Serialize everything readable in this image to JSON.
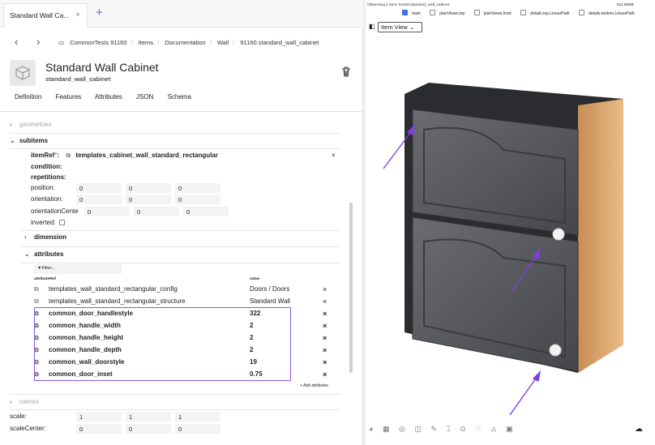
{
  "window": {
    "tab_title": "Standard Wall Ca...",
    "close": "×",
    "new_tab": "+"
  },
  "breadcrumb": [
    "CommonTests 91160",
    "Items",
    "Documentation",
    "Wall",
    "91160.standard_wall_cabinet"
  ],
  "item": {
    "title": "Standard Wall Cabinet",
    "subtitle": "standard_wall_cabinet"
  },
  "tabs": [
    "Definition",
    "Features",
    "Attributes",
    "JSON",
    "Schema"
  ],
  "sections": {
    "geometries": "geometries",
    "subitems": "subitems",
    "dimension": "dimension",
    "attributes": "attributes",
    "names": "names"
  },
  "subitem": {
    "itemref_label": "itemRef",
    "itemref_required": "*",
    "itemref_value": "templates_cabinet_wall_standard_rectangular",
    "condition": "condition:",
    "repetitions": "repetitions:",
    "position_label": "position:",
    "position": [
      "0",
      "0",
      "0"
    ],
    "orientation_label": "orientation:",
    "orientation": [
      "0",
      "0",
      "0"
    ],
    "orientation_center_label": "orientationCente",
    "orientation_center": [
      "0",
      "0",
      "0"
    ],
    "inverted_label": "inverted:"
  },
  "attributes": {
    "filter_placeholder": "Filter...",
    "col_ref": "attributeRef",
    "col_value": "value",
    "rows": [
      {
        "name": "templates_wall_standard_rectangular_config",
        "value": "Doors / Doors",
        "bold": false
      },
      {
        "name": "templates_wall_standard_rectangular_structure",
        "value": "Standard Wall",
        "bold": false
      },
      {
        "name": "common_door_handlestyle",
        "value": "322",
        "bold": true
      },
      {
        "name": "common_handle_width",
        "value": "2",
        "bold": true
      },
      {
        "name": "common_handle_height",
        "value": "2",
        "bold": true
      },
      {
        "name": "common_handle_depth",
        "value": "2",
        "bold": true
      },
      {
        "name": "common_wall_doorstyle",
        "value": "19",
        "bold": true
      },
      {
        "name": "common_door_inset",
        "value": "0.75",
        "bold": true
      }
    ],
    "add_link": "+ Add attributes"
  },
  "scale": {
    "label": "scale:",
    "values": [
      "1",
      "1",
      "1"
    ],
    "center_label": "scaleCenter:",
    "center_values": [
      "0",
      "0",
      "0"
    ]
  },
  "viewport": {
    "status": "Observing 1 item: 91160.standard_wall_cabinet",
    "fps": "611.60KB",
    "checkboxes": [
      {
        "label": "main",
        "checked": true
      },
      {
        "label": "planViews.top",
        "checked": false
      },
      {
        "label": "planViews.front",
        "checked": false
      },
      {
        "label": "details.top.LinearPath",
        "checked": false
      },
      {
        "label": "details.bottom.LinearPath",
        "checked": false
      }
    ],
    "view_select": "Item View"
  },
  "colors": {
    "accent": "#8a56e8",
    "arrow": "#7f3fe0",
    "cabinet_door": "#55575b",
    "cabinet_side": "#d9a66f"
  }
}
